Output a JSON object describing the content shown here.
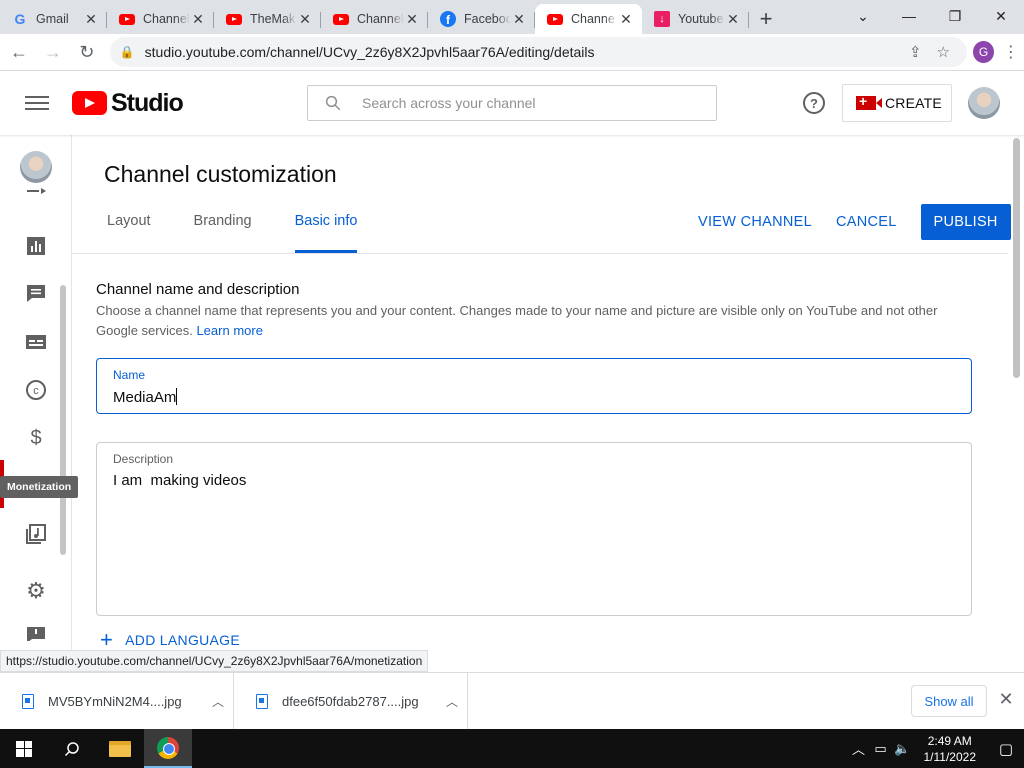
{
  "browser": {
    "tabs": [
      {
        "title": "Gmail",
        "icon": "gmail-icon",
        "active": false
      },
      {
        "title": "Channel",
        "icon": "youtube-icon",
        "active": false
      },
      {
        "title": "TheMak",
        "icon": "youtube-icon",
        "active": false
      },
      {
        "title": "Channel",
        "icon": "youtube-icon",
        "active": false
      },
      {
        "title": "Facebook",
        "icon": "facebook-icon",
        "active": false
      },
      {
        "title": "Channe",
        "icon": "youtube-icon",
        "active": true
      },
      {
        "title": "Youtube",
        "icon": "download-icon",
        "active": false
      }
    ],
    "url": "studio.youtube.com/channel/UCvy_2z6y8X2Jpvhl5aar76A/editing/details",
    "profile_initial": "G",
    "status_url": "https://studio.youtube.com/channel/UCvy_2z6y8X2Jpvhl5aar76A/monetization"
  },
  "header": {
    "logo_text": "Studio",
    "search_placeholder": "Search across your channel",
    "create_label": "CREATE"
  },
  "sidebar": {
    "tooltip": "Monetization",
    "items": [
      "content-icon",
      "analytics-icon",
      "comments-icon",
      "subtitles-icon",
      "copyright-icon",
      "monetization-icon",
      "customization-icon",
      "audio-library-icon",
      "settings-icon",
      "feedback-icon"
    ]
  },
  "page": {
    "title": "Channel customization",
    "tabs": [
      {
        "label": "Layout",
        "active": false
      },
      {
        "label": "Branding",
        "active": false
      },
      {
        "label": "Basic info",
        "active": true
      }
    ],
    "view_channel": "VIEW CHANNEL",
    "cancel": "CANCEL",
    "publish": "PUBLISH",
    "section_title": "Channel name and description",
    "section_desc": "Choose a channel name that represents you and your content. Changes made to your name and picture are visible only on YouTube and not other Google services.",
    "learn_more": "Learn more",
    "name_label": "Name",
    "name_value": "MediaAm",
    "description_label": "Description",
    "description_value": "I am  making videos",
    "add_language": "ADD LANGUAGE"
  },
  "downloads": {
    "items": [
      {
        "name": "MV5BYmNiN2M4....jpg"
      },
      {
        "name": "dfee6f50fdab2787....jpg"
      }
    ],
    "show_all": "Show all"
  },
  "taskbar": {
    "time": "2:49 AM",
    "date": "1/11/2022"
  },
  "colors": {
    "accent": "#065fd4",
    "brand_red": "#ff0000"
  }
}
